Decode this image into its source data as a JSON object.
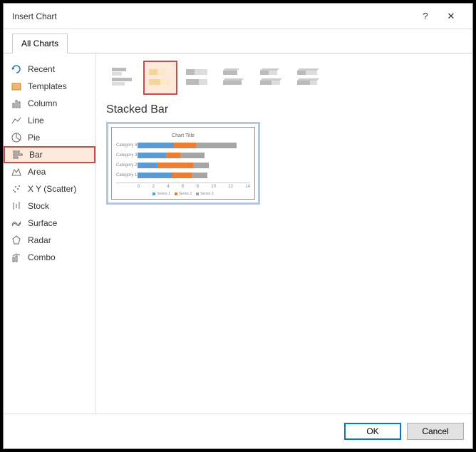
{
  "dialog": {
    "title": "Insert Chart",
    "help": "?",
    "close": "✕"
  },
  "tabs": {
    "all_charts": "All Charts"
  },
  "sidebar": {
    "items": [
      {
        "label": "Recent",
        "icon": "recent"
      },
      {
        "label": "Templates",
        "icon": "templates"
      },
      {
        "label": "Column",
        "icon": "column"
      },
      {
        "label": "Line",
        "icon": "line"
      },
      {
        "label": "Pie",
        "icon": "pie"
      },
      {
        "label": "Bar",
        "icon": "bar",
        "selected": true
      },
      {
        "label": "Area",
        "icon": "area"
      },
      {
        "label": "X Y (Scatter)",
        "icon": "scatter"
      },
      {
        "label": "Stock",
        "icon": "stock"
      },
      {
        "label": "Surface",
        "icon": "surface"
      },
      {
        "label": "Radar",
        "icon": "radar"
      },
      {
        "label": "Combo",
        "icon": "combo"
      }
    ]
  },
  "subtypes": {
    "items": [
      {
        "name": "clustered-bar"
      },
      {
        "name": "stacked-bar",
        "selected": true
      },
      {
        "name": "stacked-bar-100"
      },
      {
        "name": "clustered-bar-3d"
      },
      {
        "name": "stacked-bar-3d"
      },
      {
        "name": "stacked-bar-100-3d"
      }
    ],
    "selected_label": "Stacked Bar"
  },
  "chart_data": {
    "type": "bar",
    "title": "Chart Title",
    "categories": [
      "Category 4",
      "Category 3",
      "Category 2",
      "Category 1"
    ],
    "series": [
      {
        "name": "Series 1",
        "values": [
          4.5,
          3.5,
          2.5,
          4.3
        ]
      },
      {
        "name": "Series 2",
        "values": [
          2.8,
          1.8,
          4.4,
          2.4
        ]
      },
      {
        "name": "Series 3",
        "values": [
          5.0,
          3.0,
          2.0,
          2.0
        ]
      }
    ],
    "xlabel": "",
    "ylabel": "",
    "xlim": [
      0,
      14
    ],
    "xticks": [
      0,
      2,
      4,
      6,
      8,
      10,
      12,
      14
    ],
    "legend_position": "bottom"
  },
  "footer": {
    "ok": "OK",
    "cancel": "Cancel"
  }
}
